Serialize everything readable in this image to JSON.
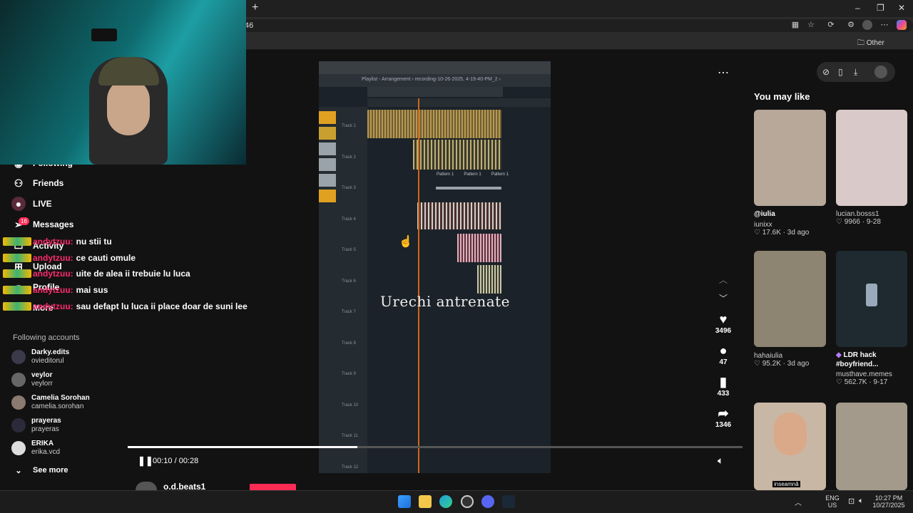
{
  "browser": {
    "new_tab_label": "+",
    "url_text": "46",
    "other_favorites": "Other favorites",
    "window_controls": [
      "–",
      "❐",
      "✕"
    ]
  },
  "sidebar": {
    "items": [
      {
        "label": "Following",
        "icon": "users-icon"
      },
      {
        "label": "Friends",
        "icon": "friends-icon"
      },
      {
        "label": "LIVE",
        "icon": "live-icon"
      },
      {
        "label": "Messages",
        "icon": "messages-icon",
        "badge": "16"
      },
      {
        "label": "Activity",
        "icon": "activity-icon"
      },
      {
        "label": "Upload",
        "icon": "upload-icon"
      },
      {
        "label": "Profile",
        "icon": "profile-icon"
      },
      {
        "label": "More",
        "icon": "more-icon"
      }
    ],
    "following_title": "Following accounts",
    "accounts": [
      {
        "name": "Darky.edits",
        "handle": "ovieditorul"
      },
      {
        "name": "veylor",
        "handle": "veylorr"
      },
      {
        "name": "Camelia Sorohan",
        "handle": "camelia.sorohan"
      },
      {
        "name": "prayeras",
        "handle": "prayeras"
      },
      {
        "name": "ERIKA",
        "handle": "erika.vcd"
      }
    ],
    "see_more": "See more"
  },
  "chat": {
    "messages": [
      {
        "user": "andytzuu:",
        "text": "nu stii tu"
      },
      {
        "user": "andytzuu:",
        "text": "ce cauti omule"
      },
      {
        "user": "andytzuu:",
        "text": "uite de alea ii trebuie lu luca"
      },
      {
        "user": "andytzuu:",
        "text": "mai sus"
      },
      {
        "user": "andytzuu:",
        "text": "sau defapt lu luca ii place doar de suni lee"
      }
    ],
    "badge_number": "1"
  },
  "video": {
    "caption": "Urechi antrenate",
    "playlist_title": "Playlist - Arrangement › recording-10-26-2025, 4-19-40-PM_2 ›",
    "track_labels": [
      "Track 1",
      "Track 2",
      "Track 3",
      "Track 4",
      "Track 5",
      "Track 6",
      "Track 7",
      "Track 8",
      "Track 9",
      "Track 10",
      "Track 11",
      "Track 12"
    ],
    "pattern_labels": [
      "Pattern 1",
      "Pattern 1",
      "Pattern 1"
    ],
    "time": "00:10 / 00:28",
    "progress": 0.373,
    "author": "o.d.beats1",
    "likes": "3496",
    "comments": "47",
    "saves": "433",
    "shares": "1346"
  },
  "recommendations": {
    "title": "You may like",
    "items": [
      {
        "title": "@iulia",
        "author": "iunixx",
        "likes": "17.6K",
        "date": "3d ago",
        "color": "#b8a89a"
      },
      {
        "title": "",
        "author": "lucian.bosss1",
        "likes": "9966",
        "date": "9-28",
        "color": "#d9c9c8"
      },
      {
        "title": "",
        "author": "hahaiulia",
        "likes": "95.2K",
        "date": "3d ago",
        "color": "#8d8471"
      },
      {
        "title": "LDR hack #boyfriend...",
        "author": "musthave.memes",
        "likes": "562.7K",
        "date": "9-17",
        "color": "#1e2a30"
      },
      {
        "title": "",
        "author": "",
        "likes": "",
        "date": "",
        "color": "#c9b7a5",
        "overlay": "inseamnă"
      },
      {
        "title": "",
        "author": "",
        "likes": "",
        "date": "",
        "color": "#a39a8c"
      }
    ]
  },
  "taskbar": {
    "lang": "ENG",
    "region": "US",
    "time": "10:27 PM",
    "date": "10/27/2025"
  }
}
